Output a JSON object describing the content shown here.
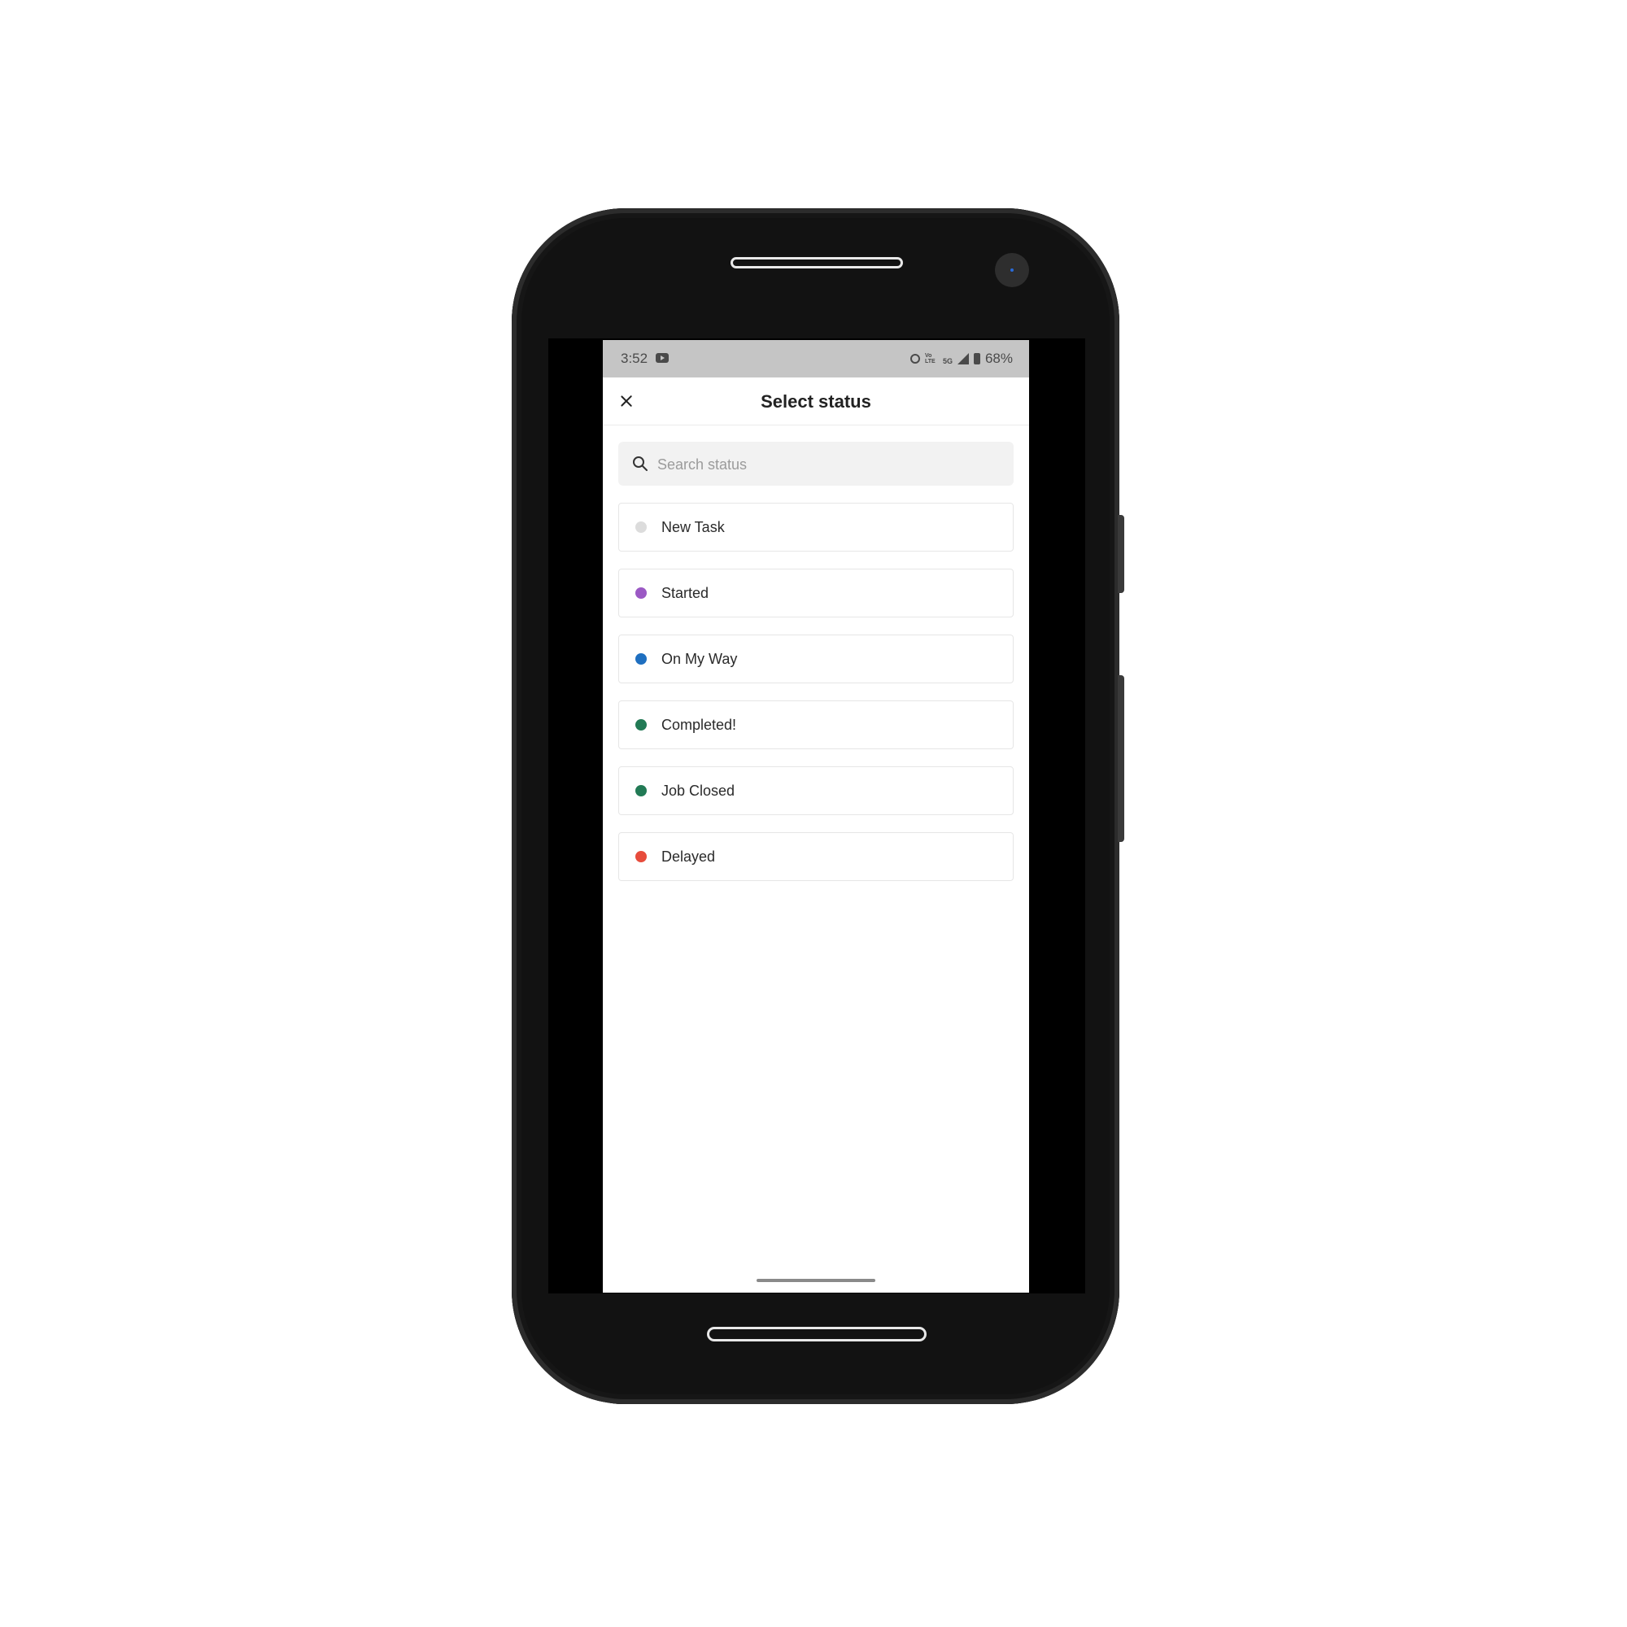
{
  "status_bar": {
    "time": "3:52",
    "volte_label": "Vo LTE",
    "network_label": "5G",
    "battery_percent": "68%"
  },
  "modal": {
    "title": "Select status",
    "close_icon": "close-icon"
  },
  "search": {
    "placeholder": "Search status",
    "value": "",
    "icon": "search-icon"
  },
  "statuses": [
    {
      "label": "New Task",
      "color": "#dcdcdc"
    },
    {
      "label": "Started",
      "color": "#9b59c4"
    },
    {
      "label": "On My Way",
      "color": "#1f6fc0"
    },
    {
      "label": "Completed!",
      "color": "#227a55"
    },
    {
      "label": "Job Closed",
      "color": "#227a55"
    },
    {
      "label": "Delayed",
      "color": "#e74c3c"
    }
  ]
}
